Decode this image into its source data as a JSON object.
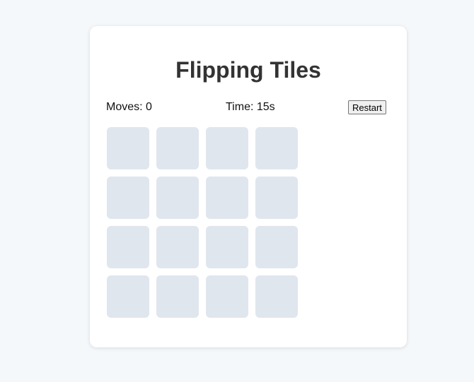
{
  "game": {
    "title": "Flipping Tiles",
    "moves_label": "Moves: 0",
    "time_label": "Time: 15s",
    "restart_label": "Restart",
    "tile_count": 16
  },
  "colors": {
    "background": "#f5f8fb",
    "card": "#ffffff",
    "tile": "#e0e6ee",
    "title": "#333333"
  }
}
